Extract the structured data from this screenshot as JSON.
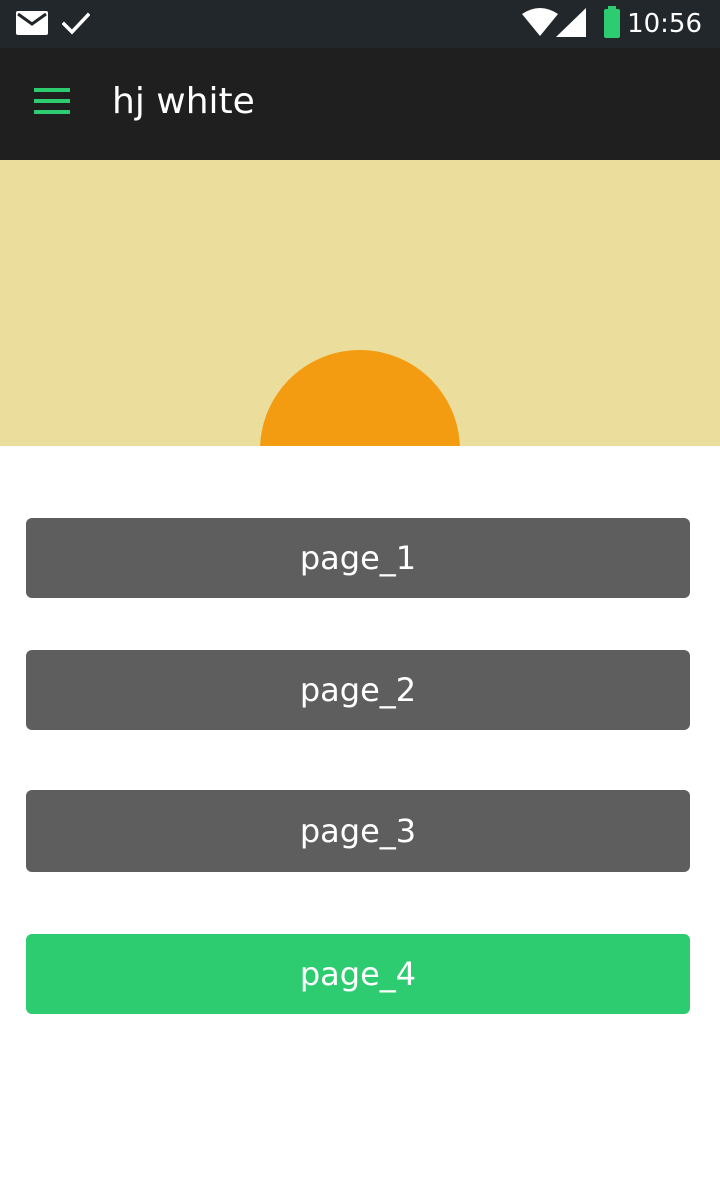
{
  "status_bar": {
    "time": "10:56",
    "icons": [
      "mail-icon",
      "check-icon",
      "wifi-icon",
      "signal-icon",
      "battery-icon"
    ]
  },
  "app_bar": {
    "title": "hj white",
    "menu_icon": "hamburger-menu-icon"
  },
  "banner": {
    "background_color": "#ebdd9b",
    "sun_color": "#f39c12"
  },
  "buttons": [
    {
      "label": "page_1",
      "active": false
    },
    {
      "label": "page_2",
      "active": false
    },
    {
      "label": "page_3",
      "active": false
    },
    {
      "label": "page_4",
      "active": true
    }
  ],
  "colors": {
    "accent": "#2ecc71",
    "button_default": "#5e5e5e",
    "app_bar": "#1f1f1f",
    "status_bar": "#22272b"
  }
}
